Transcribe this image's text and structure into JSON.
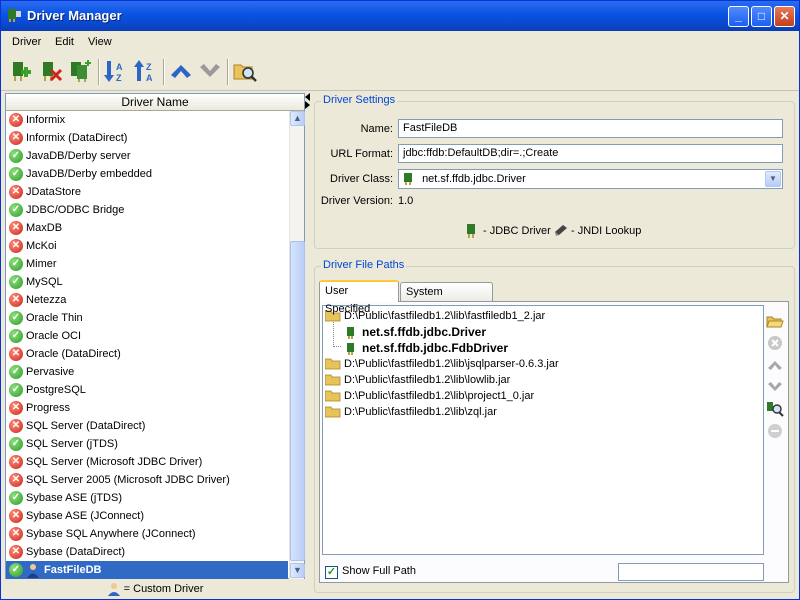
{
  "window": {
    "title": "Driver Manager",
    "minimize": "_",
    "maximize": "□",
    "close": "✕"
  },
  "menu": [
    "Driver",
    "Edit",
    "View"
  ],
  "toolbar": [
    {
      "icon": "add-driver-icon"
    },
    {
      "icon": "remove-driver-icon"
    },
    {
      "icon": "copy-driver-icon"
    },
    {
      "icon": "sort-ascending-icon"
    },
    {
      "icon": "sort-descending-icon"
    },
    {
      "icon": "move-up-icon"
    },
    {
      "icon": "move-down-icon"
    },
    {
      "icon": "search-folder-icon"
    }
  ],
  "driver_list": {
    "column_header": "Driver Name",
    "items": [
      {
        "name": "Informix",
        "status": "error"
      },
      {
        "name": "Informix (DataDirect)",
        "status": "error"
      },
      {
        "name": "JavaDB/Derby server",
        "status": "ok"
      },
      {
        "name": "JavaDB/Derby embedded",
        "status": "ok"
      },
      {
        "name": "JDataStore",
        "status": "error"
      },
      {
        "name": "JDBC/ODBC Bridge",
        "status": "ok"
      },
      {
        "name": "MaxDB",
        "status": "error"
      },
      {
        "name": "McKoi",
        "status": "error"
      },
      {
        "name": "Mimer",
        "status": "ok"
      },
      {
        "name": "MySQL",
        "status": "ok"
      },
      {
        "name": "Netezza",
        "status": "error"
      },
      {
        "name": "Oracle Thin",
        "status": "ok"
      },
      {
        "name": "Oracle OCI",
        "status": "ok"
      },
      {
        "name": "Oracle (DataDirect)",
        "status": "error"
      },
      {
        "name": "Pervasive",
        "status": "ok"
      },
      {
        "name": "PostgreSQL",
        "status": "ok"
      },
      {
        "name": "Progress",
        "status": "error"
      },
      {
        "name": "SQL Server (DataDirect)",
        "status": "error"
      },
      {
        "name": "SQL Server (jTDS)",
        "status": "ok"
      },
      {
        "name": "SQL Server (Microsoft JDBC Driver)",
        "status": "error"
      },
      {
        "name": "SQL Server 2005 (Microsoft JDBC Driver)",
        "status": "error"
      },
      {
        "name": "Sybase ASE (jTDS)",
        "status": "ok"
      },
      {
        "name": "Sybase ASE (JConnect)",
        "status": "error"
      },
      {
        "name": "Sybase SQL Anywhere (JConnect)",
        "status": "error"
      },
      {
        "name": "Sybase (DataDirect)",
        "status": "error"
      },
      {
        "name": "FastFileDB",
        "status": "ok",
        "selected": true,
        "custom": true
      }
    ],
    "legend": "= Custom Driver"
  },
  "driver_settings": {
    "title": "Driver Settings",
    "name_label": "Name:",
    "name_value": "FastFileDB",
    "url_label": "URL Format:",
    "url_value": "jdbc:ffdb:DefaultDB;dir=.;Create",
    "class_label": "Driver Class:",
    "class_value": "net.sf.ffdb.jdbc.Driver",
    "version_label": "Driver Version:",
    "version_value": "1.0",
    "legend_jdbc": "- JDBC Driver",
    "legend_jndi": "- JNDI Lookup"
  },
  "file_paths": {
    "title": "Driver File Paths",
    "tab_user": "User Specified",
    "tab_system": "System Classpath",
    "entries": [
      {
        "text": "D:\\Public\\fastfiledb1.2\\lib\\fastfiledb1_2.jar",
        "type": "folder"
      },
      {
        "text": "net.sf.ffdb.jdbc.Driver",
        "type": "driver"
      },
      {
        "text": "net.sf.ffdb.jdbc.FdbDriver",
        "type": "driver"
      },
      {
        "text": "D:\\Public\\fastfiledb1.2\\lib\\jsqlparser-0.6.3.jar",
        "type": "folder"
      },
      {
        "text": "D:\\Public\\fastfiledb1.2\\lib\\lowlib.jar",
        "type": "folder"
      },
      {
        "text": "D:\\Public\\fastfiledb1.2\\lib\\project1_0.jar",
        "type": "folder"
      },
      {
        "text": "D:\\Public\\fastfiledb1.2\\lib\\zql.jar",
        "type": "folder"
      }
    ],
    "show_full_path_label": "Show Full Path",
    "show_full_path_checked": true,
    "side_tools": [
      "open-folder-icon",
      "remove-icon",
      "move-up-icon",
      "move-down-icon",
      "search-driver-icon",
      "stop-icon"
    ]
  },
  "colors": {
    "title_bar": "#0a53e3",
    "selection": "#316ac5",
    "group_title": "#0046d5",
    "ok": "#2b9b24",
    "error": "#c9281b"
  }
}
